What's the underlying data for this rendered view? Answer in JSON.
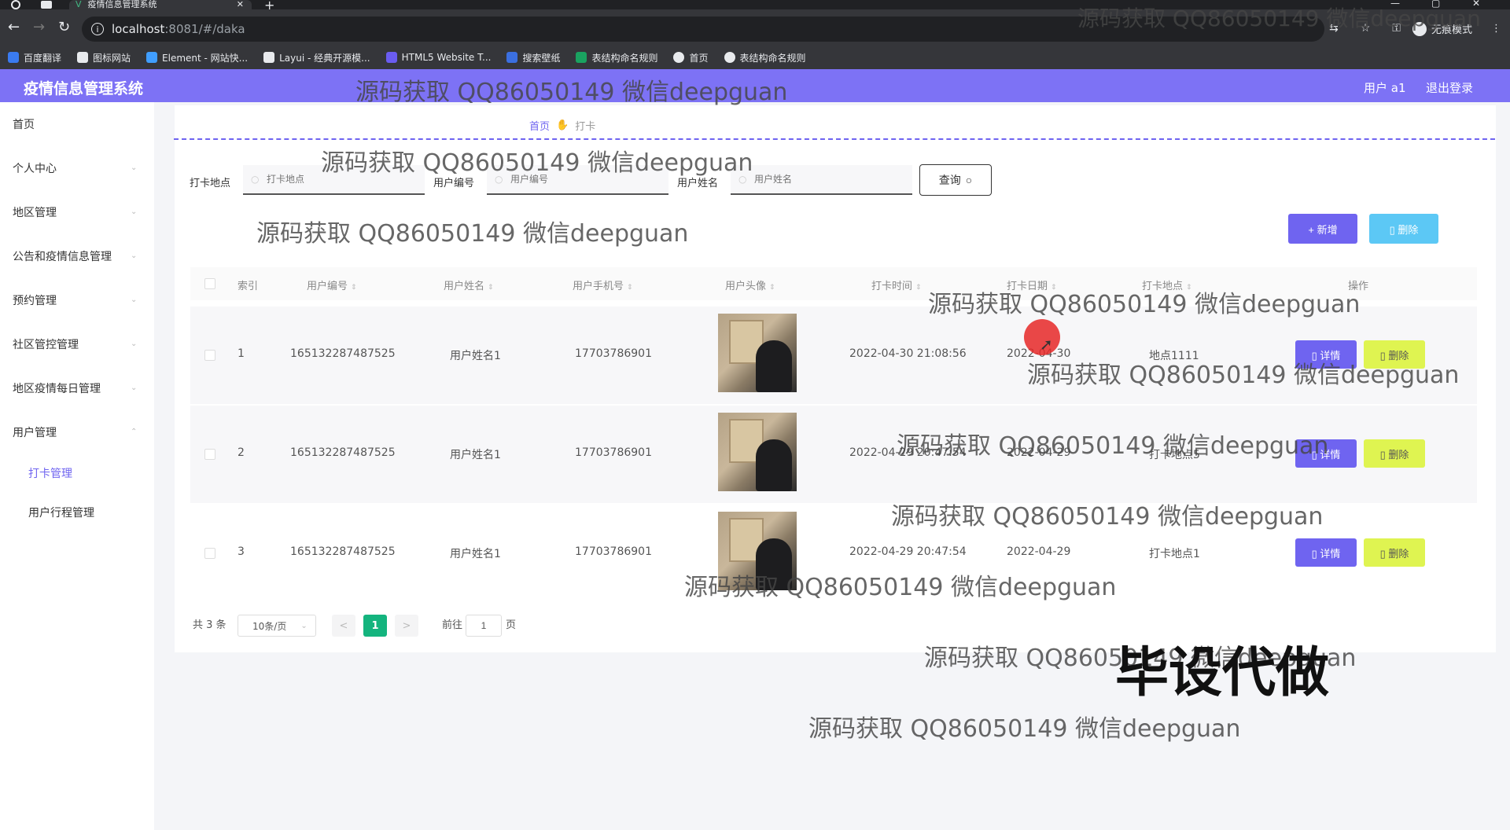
{
  "browser": {
    "tab_title": "疫情信息管理系统",
    "tab_close": "✕",
    "tab_new": "+",
    "url_host": "localhost",
    "url_path": ":8081/#/daka",
    "incognito_label": "无痕模式",
    "bookmarks": [
      "百度翻译",
      "图标网站",
      "Element - 网站快...",
      "Layui - 经典开源模...",
      "HTML5 Website T...",
      "搜索壁纸",
      "表结构命名规则",
      "首页",
      "表结构命名规则"
    ]
  },
  "header": {
    "title": "疫情信息管理系统",
    "user": "用户 a1",
    "logout": "退出登录"
  },
  "sidebar": {
    "items": [
      "首页",
      "个人中心",
      "地区管理",
      "公告和疫情信息管理",
      "预约管理",
      "社区管控管理",
      "地区疫情每日管理",
      "用户管理"
    ],
    "sub_items": [
      "打卡管理",
      "用户行程管理"
    ]
  },
  "breadcrumb": {
    "home": "首页",
    "current": "打卡"
  },
  "search": {
    "location_label": "打卡地点",
    "location_placeholder": "打卡地点",
    "usernum_label": "用户编号",
    "usernum_placeholder": "用户编号",
    "username_label": "用户姓名",
    "username_placeholder": "用户姓名",
    "query_btn": "查询"
  },
  "actions": {
    "add": "+ 新增",
    "delete": "删除"
  },
  "table": {
    "columns": [
      "索引",
      "用户编号",
      "用户姓名",
      "用户手机号",
      "用户头像",
      "打卡时间",
      "打卡日期",
      "打卡地点",
      "操作"
    ],
    "rows": [
      {
        "index": "1",
        "usernum": "165132287487525",
        "name": "用户姓名1",
        "phone": "17703786901",
        "time": "2022-04-30 21:08:56",
        "date": "2022-04-30",
        "place": "地点1111"
      },
      {
        "index": "2",
        "usernum": "165132287487525",
        "name": "用户姓名1",
        "phone": "17703786901",
        "time": "2022-04-29 20:47:54",
        "date": "2022-04-29",
        "place": "打卡地点5"
      },
      {
        "index": "3",
        "usernum": "165132287487525",
        "name": "用户姓名1",
        "phone": "17703786901",
        "time": "2022-04-29 20:47:54",
        "date": "2022-04-29",
        "place": "打卡地点1"
      }
    ],
    "detail_btn": "详情",
    "delete_btn": "删除"
  },
  "pagination": {
    "total": "共 3 条",
    "page_size": "10条/页",
    "prev": "<",
    "next": ">",
    "current": "1",
    "goto_label": "前往",
    "goto_value": "1",
    "page_suffix": "页"
  },
  "overlay": {
    "watermark": "源码获取 QQ86050149 微信deepguan",
    "big_text": "毕设代做"
  },
  "colors": {
    "accent": "#7d72f5",
    "primary_btn": "#6f64f0",
    "delete_btn": "#dff451",
    "page_active": "#14b47e"
  }
}
